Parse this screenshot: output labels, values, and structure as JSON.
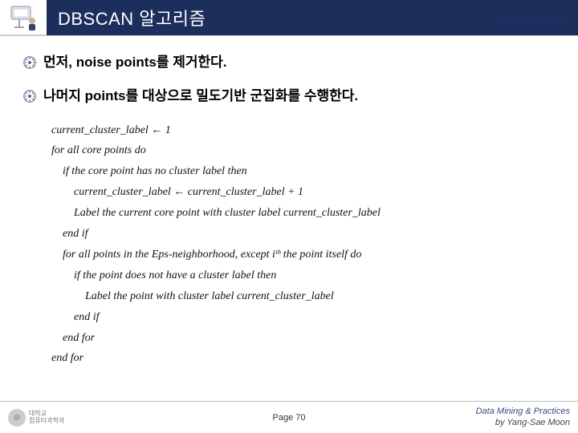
{
  "header": {
    "title": "DBSCAN 알고리즘",
    "right_label": "Cluster Analysis"
  },
  "bullets": [
    {
      "text": "먼저, noise points를 제거한다."
    },
    {
      "text": "나머지 points를 대상으로 밀도기반 군집화를 수행한다."
    }
  ],
  "pseudo": {
    "lines": [
      "current_cluster_label ← 1",
      "for all core points do",
      "    if the core point has no cluster label then",
      "        current_cluster_label ← current_cluster_label + 1",
      "        Label the current core point with cluster label current_cluster_label",
      "    end if",
      "    for all points in the Eps-neighborhood, except iᵗʰ the point itself do",
      "        if the point does not have a cluster label then",
      "            Label the point with cluster label current_cluster_label",
      "        end if",
      "    end for",
      "end for"
    ]
  },
  "footer": {
    "page": "Page 70",
    "right1": "Data Mining & Practices",
    "right2": "by Yang-Sae Moon",
    "logo_small": "대학교",
    "logo_dept": "컴퓨터과학과"
  },
  "icons": {
    "bullet_color": "#5a6a8a"
  }
}
